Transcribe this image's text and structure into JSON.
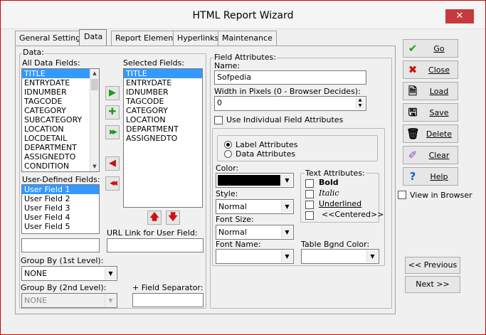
{
  "window": {
    "title": "HTML Report Wizard",
    "close_glyph": "✕"
  },
  "tabs": [
    "General Settings",
    "Data",
    "Report Elements",
    "Hyperlinks",
    "Maintenance"
  ],
  "data_group": {
    "label": "Data:",
    "all_fields_label": "All Data Fields:",
    "all_fields": [
      "TITLE",
      "ENTRYDATE",
      "IDNUMBER",
      "TAGCODE",
      "CATEGORY",
      "SUBCATEGORY",
      "LOCATION",
      "LOCDETAIL",
      "DEPARTMENT",
      "ASSIGNEDTO",
      "CONDITION"
    ],
    "selected_fields_label": "Selected Fields:",
    "selected_fields": [
      "TITLE",
      "ENTRYDATE",
      "IDNUMBER",
      "TAGCODE",
      "CATEGORY",
      "LOCATION",
      "DEPARTMENT",
      "ASSIGNEDTO"
    ],
    "user_defined_label": "User-Defined Fields:",
    "user_defined": [
      "User Field 1",
      "User Field 2",
      "User Field 3",
      "User Field 4",
      "User Field 5"
    ],
    "url_link_label": "URL Link for User Field:",
    "group_by_1_label": "Group By (1st Level):",
    "group_by_1_value": "NONE",
    "group_by_2_label": "Group By (2nd Level):",
    "group_by_2_value": "NONE",
    "field_separator_label": "+ Field Separator:",
    "move_icons": {
      "add": "▶",
      "add_custom": "✚",
      "add_all": "▶▶",
      "remove": "◀",
      "remove_all": "◀◀",
      "up": "🡅",
      "down": "🡇"
    }
  },
  "field_attributes": {
    "label": "Field Attributes:",
    "name_label": "Name:",
    "name_value": "Sofpedia",
    "width_label": "Width in Pixels (0 - Browser Decides):",
    "width_value": "0",
    "use_individual_label": "Use Individual Field Attributes",
    "label_attrs": "Label Attributes",
    "data_attrs": "Data Attributes",
    "color_label": "Color:",
    "style_label": "Style:",
    "style_value": "Normal",
    "font_size_label": "Font Size:",
    "font_size_value": "Normal",
    "font_name_label": "Font Name:",
    "font_name_value": "",
    "table_bgnd_label": "Table Bgnd Color:",
    "table_bgnd_value": "",
    "text_attrs_label": "Text Attributes:",
    "bold": "Bold",
    "italic": "Italic",
    "underlined": "Underlined",
    "centered": "<<Centered>>"
  },
  "side_buttons": [
    {
      "label": "Go",
      "icon": "check-icon"
    },
    {
      "label": "Close",
      "icon": "x-icon"
    },
    {
      "label": "Load",
      "icon": "document-icon"
    },
    {
      "label": "Save",
      "icon": "save-icon"
    },
    {
      "label": "Delete",
      "icon": "trash-icon"
    },
    {
      "label": "Clear",
      "icon": "eraser-icon"
    },
    {
      "label": "Help",
      "icon": "question-icon"
    }
  ],
  "view_in_browser": "View in Browser",
  "nav": {
    "previous": "<< Previous",
    "next": "Next >>"
  },
  "colors": {
    "selection": "#3399ff",
    "color_swatch": "#000000",
    "close_red": "#c8393b"
  }
}
